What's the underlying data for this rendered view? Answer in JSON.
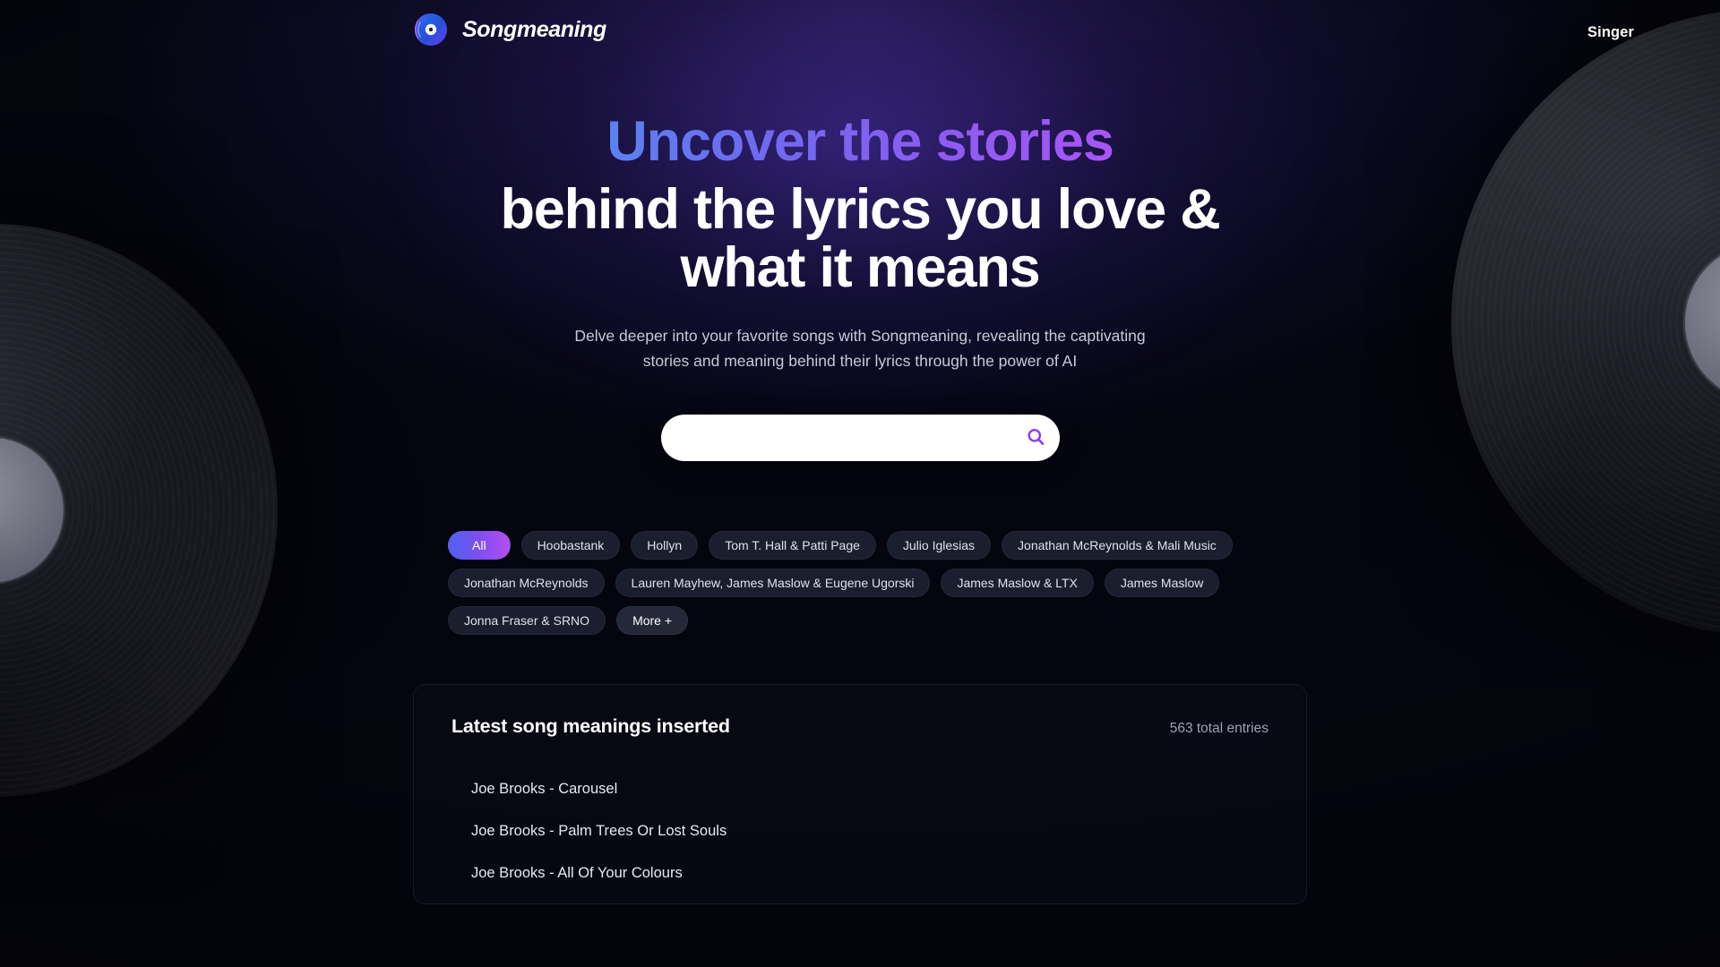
{
  "brand": {
    "name": "Songmeaning",
    "logo_icon": "vinyl-record-icon"
  },
  "nav": {
    "items": [
      {
        "label": "Singer"
      }
    ]
  },
  "hero": {
    "title_gradient": "Uncover the stories",
    "title_rest": "behind the lyrics you love & what it means",
    "subtitle": "Delve deeper into your favorite songs with Songmeaning, revealing the captivating stories and meaning behind their lyrics through the power of AI"
  },
  "search": {
    "value": "",
    "placeholder": "",
    "button_icon": "search-icon",
    "accent": "#8a3ff0"
  },
  "filters": {
    "tags": [
      {
        "label": "All",
        "active": true
      },
      {
        "label": "Hoobastank",
        "active": false
      },
      {
        "label": "Hollyn",
        "active": false
      },
      {
        "label": "Tom T. Hall & Patti Page",
        "active": false
      },
      {
        "label": "Julio Iglesias",
        "active": false
      },
      {
        "label": "Jonathan McReynolds & Mali Music",
        "active": false
      },
      {
        "label": "Jonathan McReynolds",
        "active": false
      },
      {
        "label": "Lauren Mayhew, James Maslow & Eugene Ugorski",
        "active": false
      },
      {
        "label": "James Maslow & LTX",
        "active": false
      },
      {
        "label": "James Maslow",
        "active": false
      },
      {
        "label": "Jonna Fraser & SRNO",
        "active": false
      }
    ],
    "more_label": "More +"
  },
  "latest": {
    "title": "Latest song meanings inserted",
    "count_label": "563 total entries",
    "songs": [
      {
        "label": "Joe Brooks - Carousel"
      },
      {
        "label": "Joe Brooks - Palm Trees Or Lost Souls"
      },
      {
        "label": "Joe Brooks - All Of Your Colours"
      }
    ]
  },
  "theme": {
    "background": "#05050f",
    "gradient_start": "#5b82f0",
    "gradient_end": "#a855f7",
    "card_background": "#0a0b16"
  }
}
